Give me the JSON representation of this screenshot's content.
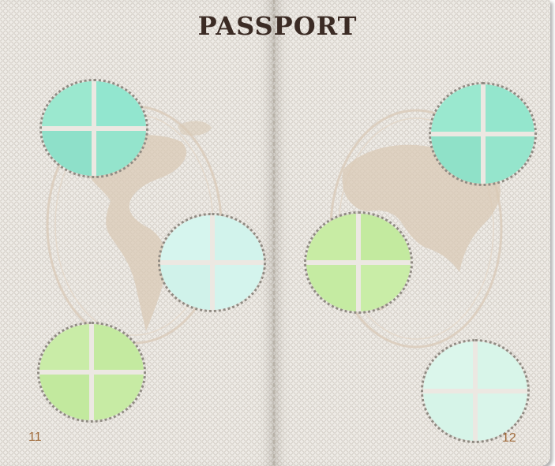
{
  "document": {
    "title": "PASSPORT",
    "left_page_number": "11",
    "right_page_number": "12"
  },
  "colors": {
    "page_background": "#eeebe6",
    "title_color": "#3b2b24",
    "page_number_color": "#a06a3a",
    "stamp_border": "#8f8a82",
    "stamp_aqua": "#8fe3c9",
    "stamp_pale_aqua": "#d2f3ec",
    "stamp_lime": "#c6eba2",
    "stamp_pale_mint": "#d9f5ea",
    "map_tint": "#d9c9b6"
  },
  "decorations": {
    "background": "guilloche-pattern",
    "watermark": "world-map-globe-watermark",
    "stamps": [
      {
        "page": "left",
        "color": "aqua"
      },
      {
        "page": "left",
        "color": "pale-aqua"
      },
      {
        "page": "left",
        "color": "lime"
      },
      {
        "page": "right",
        "color": "aqua"
      },
      {
        "page": "right",
        "color": "lime"
      },
      {
        "page": "right",
        "color": "pale-mint"
      }
    ]
  }
}
